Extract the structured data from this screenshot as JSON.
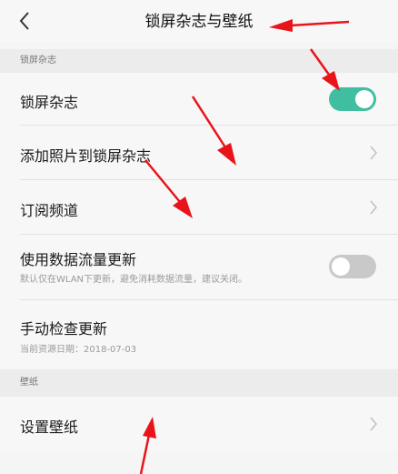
{
  "header": {
    "title": "锁屏杂志与壁纸",
    "back_icon": "back-arrow-icon"
  },
  "sections": [
    {
      "label": "锁屏杂志"
    },
    {
      "label": "壁纸"
    }
  ],
  "rows": {
    "magazine": {
      "label": "锁屏杂志",
      "toggle_on": true
    },
    "add_photos": {
      "label": "添加照片到锁屏杂志"
    },
    "subscribe": {
      "label": "订阅频道"
    },
    "data_update": {
      "label": "使用数据流量更新",
      "sub": "默认仅在WLAN下更新，避免消耗数据流量，建议关闭。",
      "toggle_on": false
    },
    "manual_check": {
      "label": "手动检查更新",
      "sub": "当前资源日期：2018-07-03"
    },
    "set_wallpaper": {
      "label": "设置壁纸"
    }
  },
  "colors": {
    "toggle_on": "#3fbf9f",
    "toggle_off": "#c9c9c9",
    "annotation_arrow": "#e8141a"
  }
}
